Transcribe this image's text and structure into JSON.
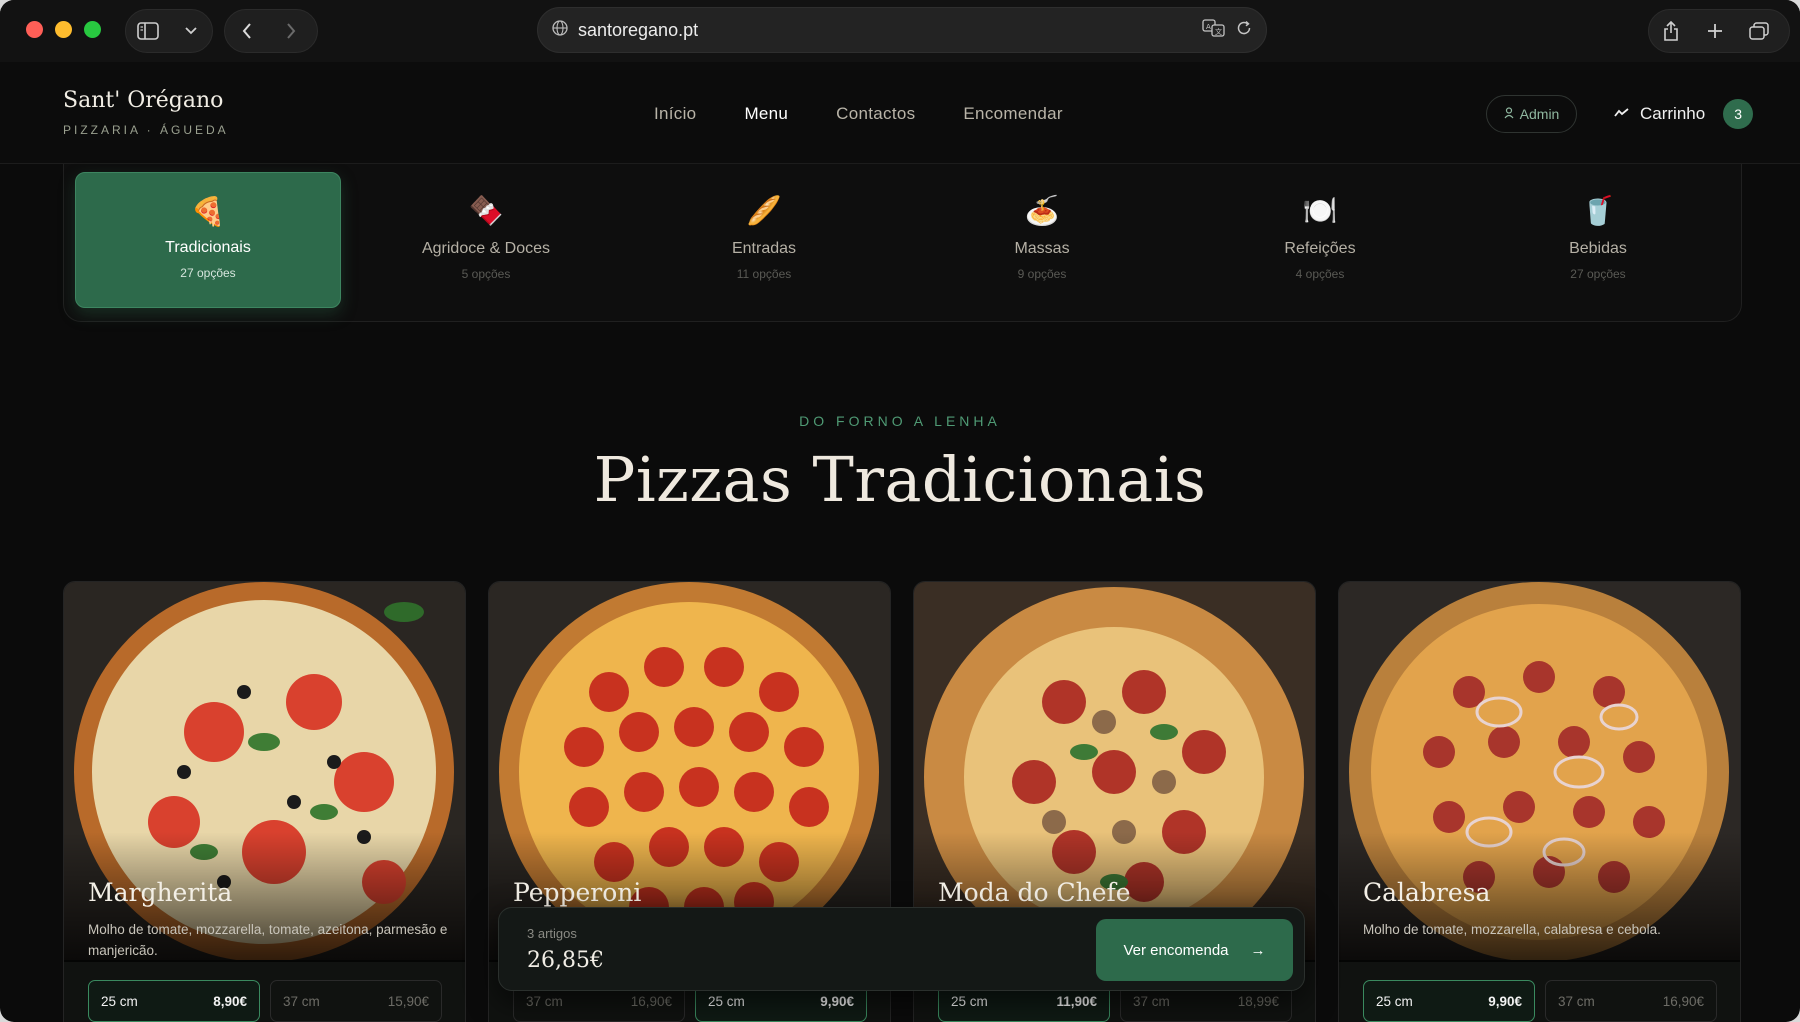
{
  "browser": {
    "url": "santoregano.pt"
  },
  "brand": {
    "name": "Sant' Orégano",
    "subtitle": "PIZZARIA · ÁGUEDA"
  },
  "nav": {
    "items": [
      {
        "label": "Início"
      },
      {
        "label": "Menu"
      },
      {
        "label": "Contactos"
      },
      {
        "label": "Encomendar"
      }
    ]
  },
  "header": {
    "admin_label": "Admin",
    "cart_label": "Carrinho",
    "cart_count": "3"
  },
  "categories": [
    {
      "emoji": "🍕",
      "label": "Tradicionais",
      "count": "27 opções",
      "active": true
    },
    {
      "emoji": "🍫",
      "label": "Agridoce & Doces",
      "count": "5 opções",
      "active": false
    },
    {
      "emoji": "🥖",
      "label": "Entradas",
      "count": "11 opções",
      "active": false
    },
    {
      "emoji": "🍝",
      "label": "Massas",
      "count": "9 opções",
      "active": false
    },
    {
      "emoji": "🍽️",
      "label": "Refeições",
      "count": "4 opções",
      "active": false
    },
    {
      "emoji": "🥤",
      "label": "Bebidas",
      "count": "27 opções",
      "active": false
    }
  ],
  "section": {
    "eyebrow": "DO FORNO A LENHA",
    "title": "Pizzas Tradicionais"
  },
  "products": [
    {
      "name": "Margherita",
      "description": "Molho de tomate, mozzarella, tomate, azeitona, parmesão e manjericão.",
      "sizes": [
        {
          "size": "25 cm",
          "price": "8,90€",
          "selected": true
        },
        {
          "size": "37 cm",
          "price": "15,90€",
          "selected": false
        }
      ]
    },
    {
      "name": "Pepperoni",
      "description": "",
      "sizes": [
        {
          "size": "37 cm",
          "price": "16,90€",
          "selected": false
        },
        {
          "size": "25 cm",
          "price": "9,90€",
          "selected": true
        }
      ]
    },
    {
      "name": "Moda do Chefe",
      "description": "",
      "sizes": [
        {
          "size": "25 cm",
          "price": "11,90€",
          "selected": true
        },
        {
          "size": "37 cm",
          "price": "18,99€",
          "selected": false
        }
      ]
    },
    {
      "name": "Calabresa",
      "description": "Molho de tomate, mozzarella, calabresa e cebola.",
      "sizes": [
        {
          "size": "25 cm",
          "price": "9,90€",
          "selected": true
        },
        {
          "size": "37 cm",
          "price": "16,90€",
          "selected": false
        }
      ]
    }
  ],
  "order": {
    "count": "3 artigos",
    "total": "26,85€",
    "button_label": "Ver encomenda",
    "button_arrow": "→"
  },
  "colors": {
    "accent": "#2d6a4b",
    "background": "#0b0b0b",
    "eyebrow": "#4f9a74"
  }
}
